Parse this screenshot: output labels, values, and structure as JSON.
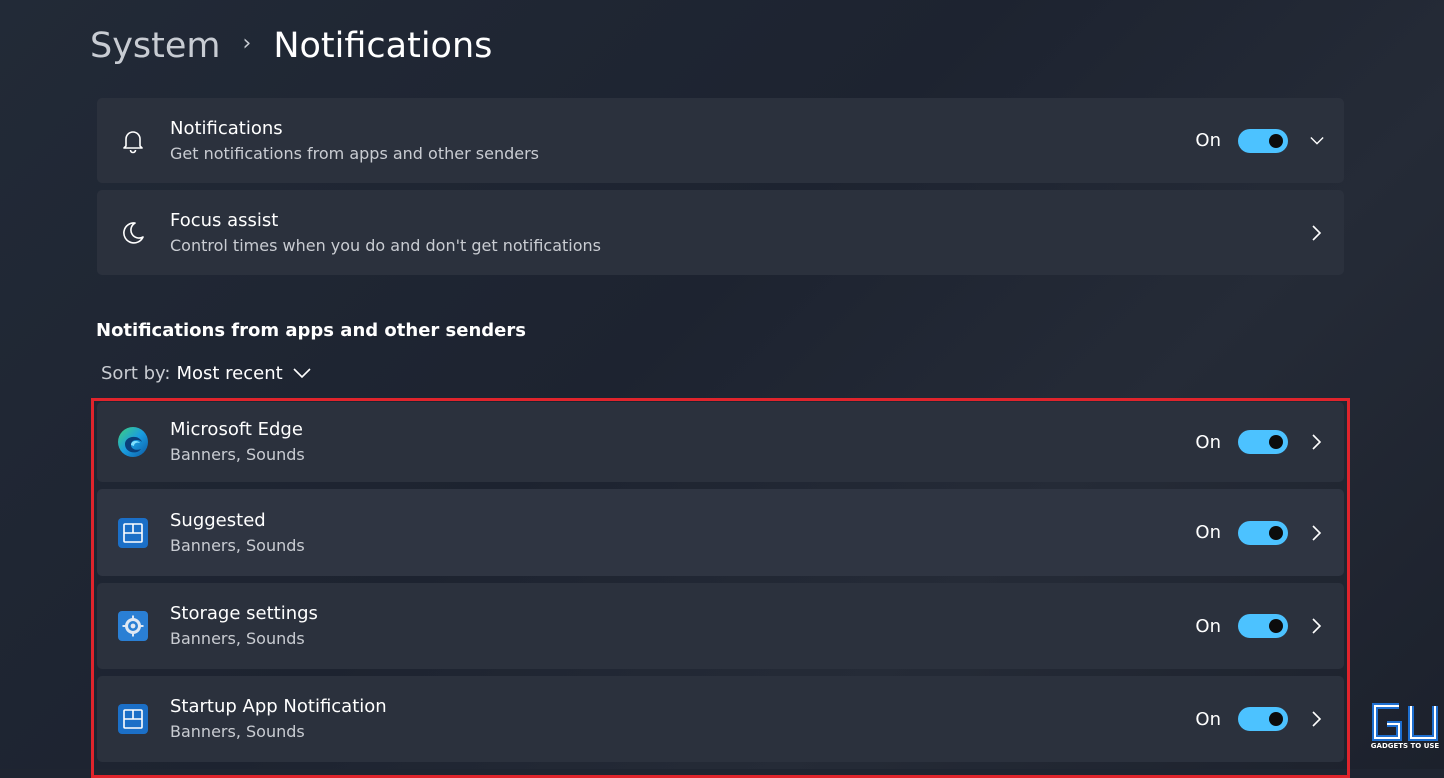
{
  "breadcrumb": {
    "parent": "System",
    "separator": "›",
    "current": "Notifications"
  },
  "top_settings": [
    {
      "title": "Notifications",
      "subtitle": "Get notifications from apps and other senders",
      "icon": "bell-icon",
      "state": "On",
      "toggle_on": true,
      "trailing": "chevron-down-icon"
    },
    {
      "title": "Focus assist",
      "subtitle": "Control times when you do and don't get notifications",
      "icon": "moon-icon",
      "trailing": "chevron-right-icon"
    }
  ],
  "apps_section": {
    "heading": "Notifications from apps and other senders",
    "sort_label": "Sort by:",
    "sort_value": "Most recent"
  },
  "apps": [
    {
      "title": "Microsoft Edge",
      "subtitle": "Banners, Sounds",
      "icon": "edge-icon",
      "state": "On",
      "toggle_on": true
    },
    {
      "title": "Suggested",
      "subtitle": "Banners, Sounds",
      "icon": "windows-tile-icon",
      "state": "On",
      "toggle_on": true
    },
    {
      "title": "Storage settings",
      "subtitle": "Banners, Sounds",
      "icon": "gear-icon",
      "state": "On",
      "toggle_on": true
    },
    {
      "title": "Startup App Notification",
      "subtitle": "Banners, Sounds",
      "icon": "windows-tile-icon",
      "state": "On",
      "toggle_on": true
    }
  ],
  "colors": {
    "toggle_on": "#4cc2ff",
    "card": "#2b313d",
    "highlight_border": "#e0242c",
    "background": "#1f2531"
  },
  "watermark": {
    "text": "GADGETS TO USE"
  }
}
